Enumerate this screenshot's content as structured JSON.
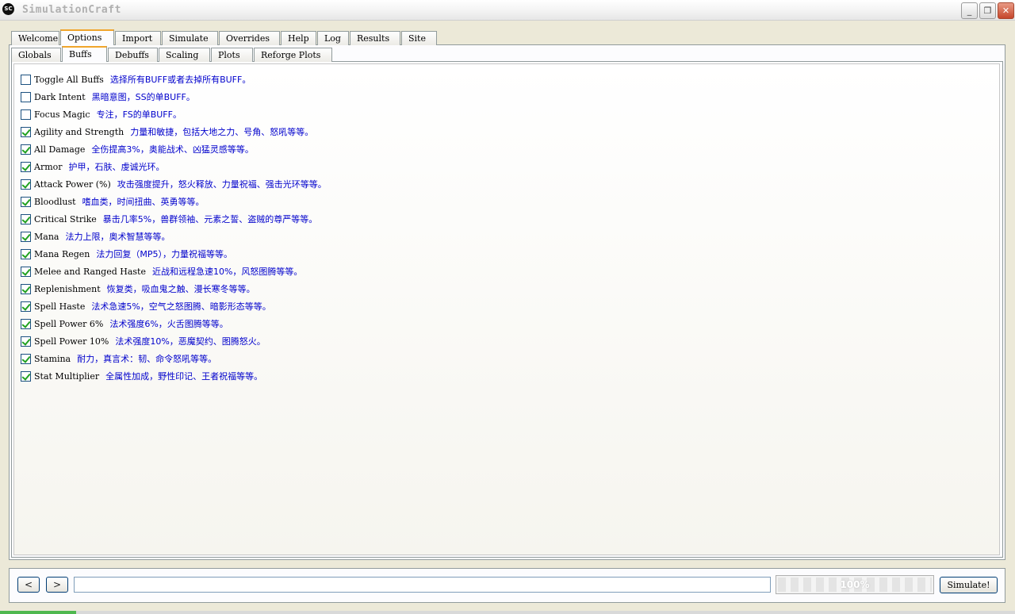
{
  "window": {
    "icon_text": "SC",
    "title": "SimulationCraft",
    "min_glyph": "_",
    "max_glyph": "❐",
    "close_glyph": "✕"
  },
  "main_tabs": [
    {
      "label": "Welcome"
    },
    {
      "label": "Options"
    },
    {
      "label": "Import"
    },
    {
      "label": "Simulate"
    },
    {
      "label": "Overrides"
    },
    {
      "label": "Help"
    },
    {
      "label": "Log"
    },
    {
      "label": "Results"
    },
    {
      "label": "Site"
    }
  ],
  "sub_tabs": [
    {
      "label": "Globals"
    },
    {
      "label": "Buffs"
    },
    {
      "label": "Debuffs"
    },
    {
      "label": "Scaling"
    },
    {
      "label": "Plots"
    },
    {
      "label": "Reforge Plots"
    }
  ],
  "buffs": [
    {
      "label": "Toggle All Buffs",
      "desc": "选择所有BUFF或者去掉所有BUFF。",
      "checked": false
    },
    {
      "label": "Dark Intent",
      "desc": "黑暗意图，SS的单BUFF。",
      "checked": false
    },
    {
      "label": "Focus Magic",
      "desc": "专注，FS的单BUFF。",
      "checked": false
    },
    {
      "label": "Agility and Strength",
      "desc": "力量和敏捷，包括大地之力、号角、怒吼等等。",
      "checked": true
    },
    {
      "label": "All Damage",
      "desc": "全伤提高3%，奥能战术、凶猛灵感等等。",
      "checked": true
    },
    {
      "label": "Armor",
      "desc": "护甲，石肤、虔诚光环。",
      "checked": true
    },
    {
      "label": "Attack Power (%)",
      "desc": "攻击强度提升，怒火释放、力量祝福、强击光环等等。",
      "checked": true
    },
    {
      "label": "Bloodlust",
      "desc": "嗜血类，时间扭曲、英勇等等。",
      "checked": true
    },
    {
      "label": "Critical Strike",
      "desc": "暴击几率5%，兽群领袖、元素之誓、盗贼的尊严等等。",
      "checked": true
    },
    {
      "label": "Mana",
      "desc": "法力上限，奥术智慧等等。",
      "checked": true
    },
    {
      "label": "Mana Regen",
      "desc": "法力回复（MP5），力量祝福等等。",
      "checked": true
    },
    {
      "label": "Melee and Ranged Haste",
      "desc": "近战和远程急速10%，风怒图腾等等。",
      "checked": true
    },
    {
      "label": "Replenishment",
      "desc": "恢复类，吸血鬼之触、漫长寒冬等等。",
      "checked": true
    },
    {
      "label": "Spell Haste",
      "desc": "法术急速5%，空气之怒图腾、暗影形态等等。",
      "checked": true
    },
    {
      "label": "Spell Power 6%",
      "desc": "法术强度6%，火舌图腾等等。",
      "checked": true
    },
    {
      "label": "Spell Power 10%",
      "desc": "法术强度10%，恶魔契约、图腾怒火。",
      "checked": true
    },
    {
      "label": "Stamina",
      "desc": "耐力，真言术：韧、命令怒吼等等。",
      "checked": true
    },
    {
      "label": "Stat Multiplier",
      "desc": "全属性加成，野性印记、王者祝福等等。",
      "checked": true
    }
  ],
  "bottom": {
    "back_glyph": "<",
    "forward_glyph": ">",
    "command_value": "",
    "progress_text": "100%",
    "progress_value": 100,
    "simulate_label": "Simulate!"
  }
}
